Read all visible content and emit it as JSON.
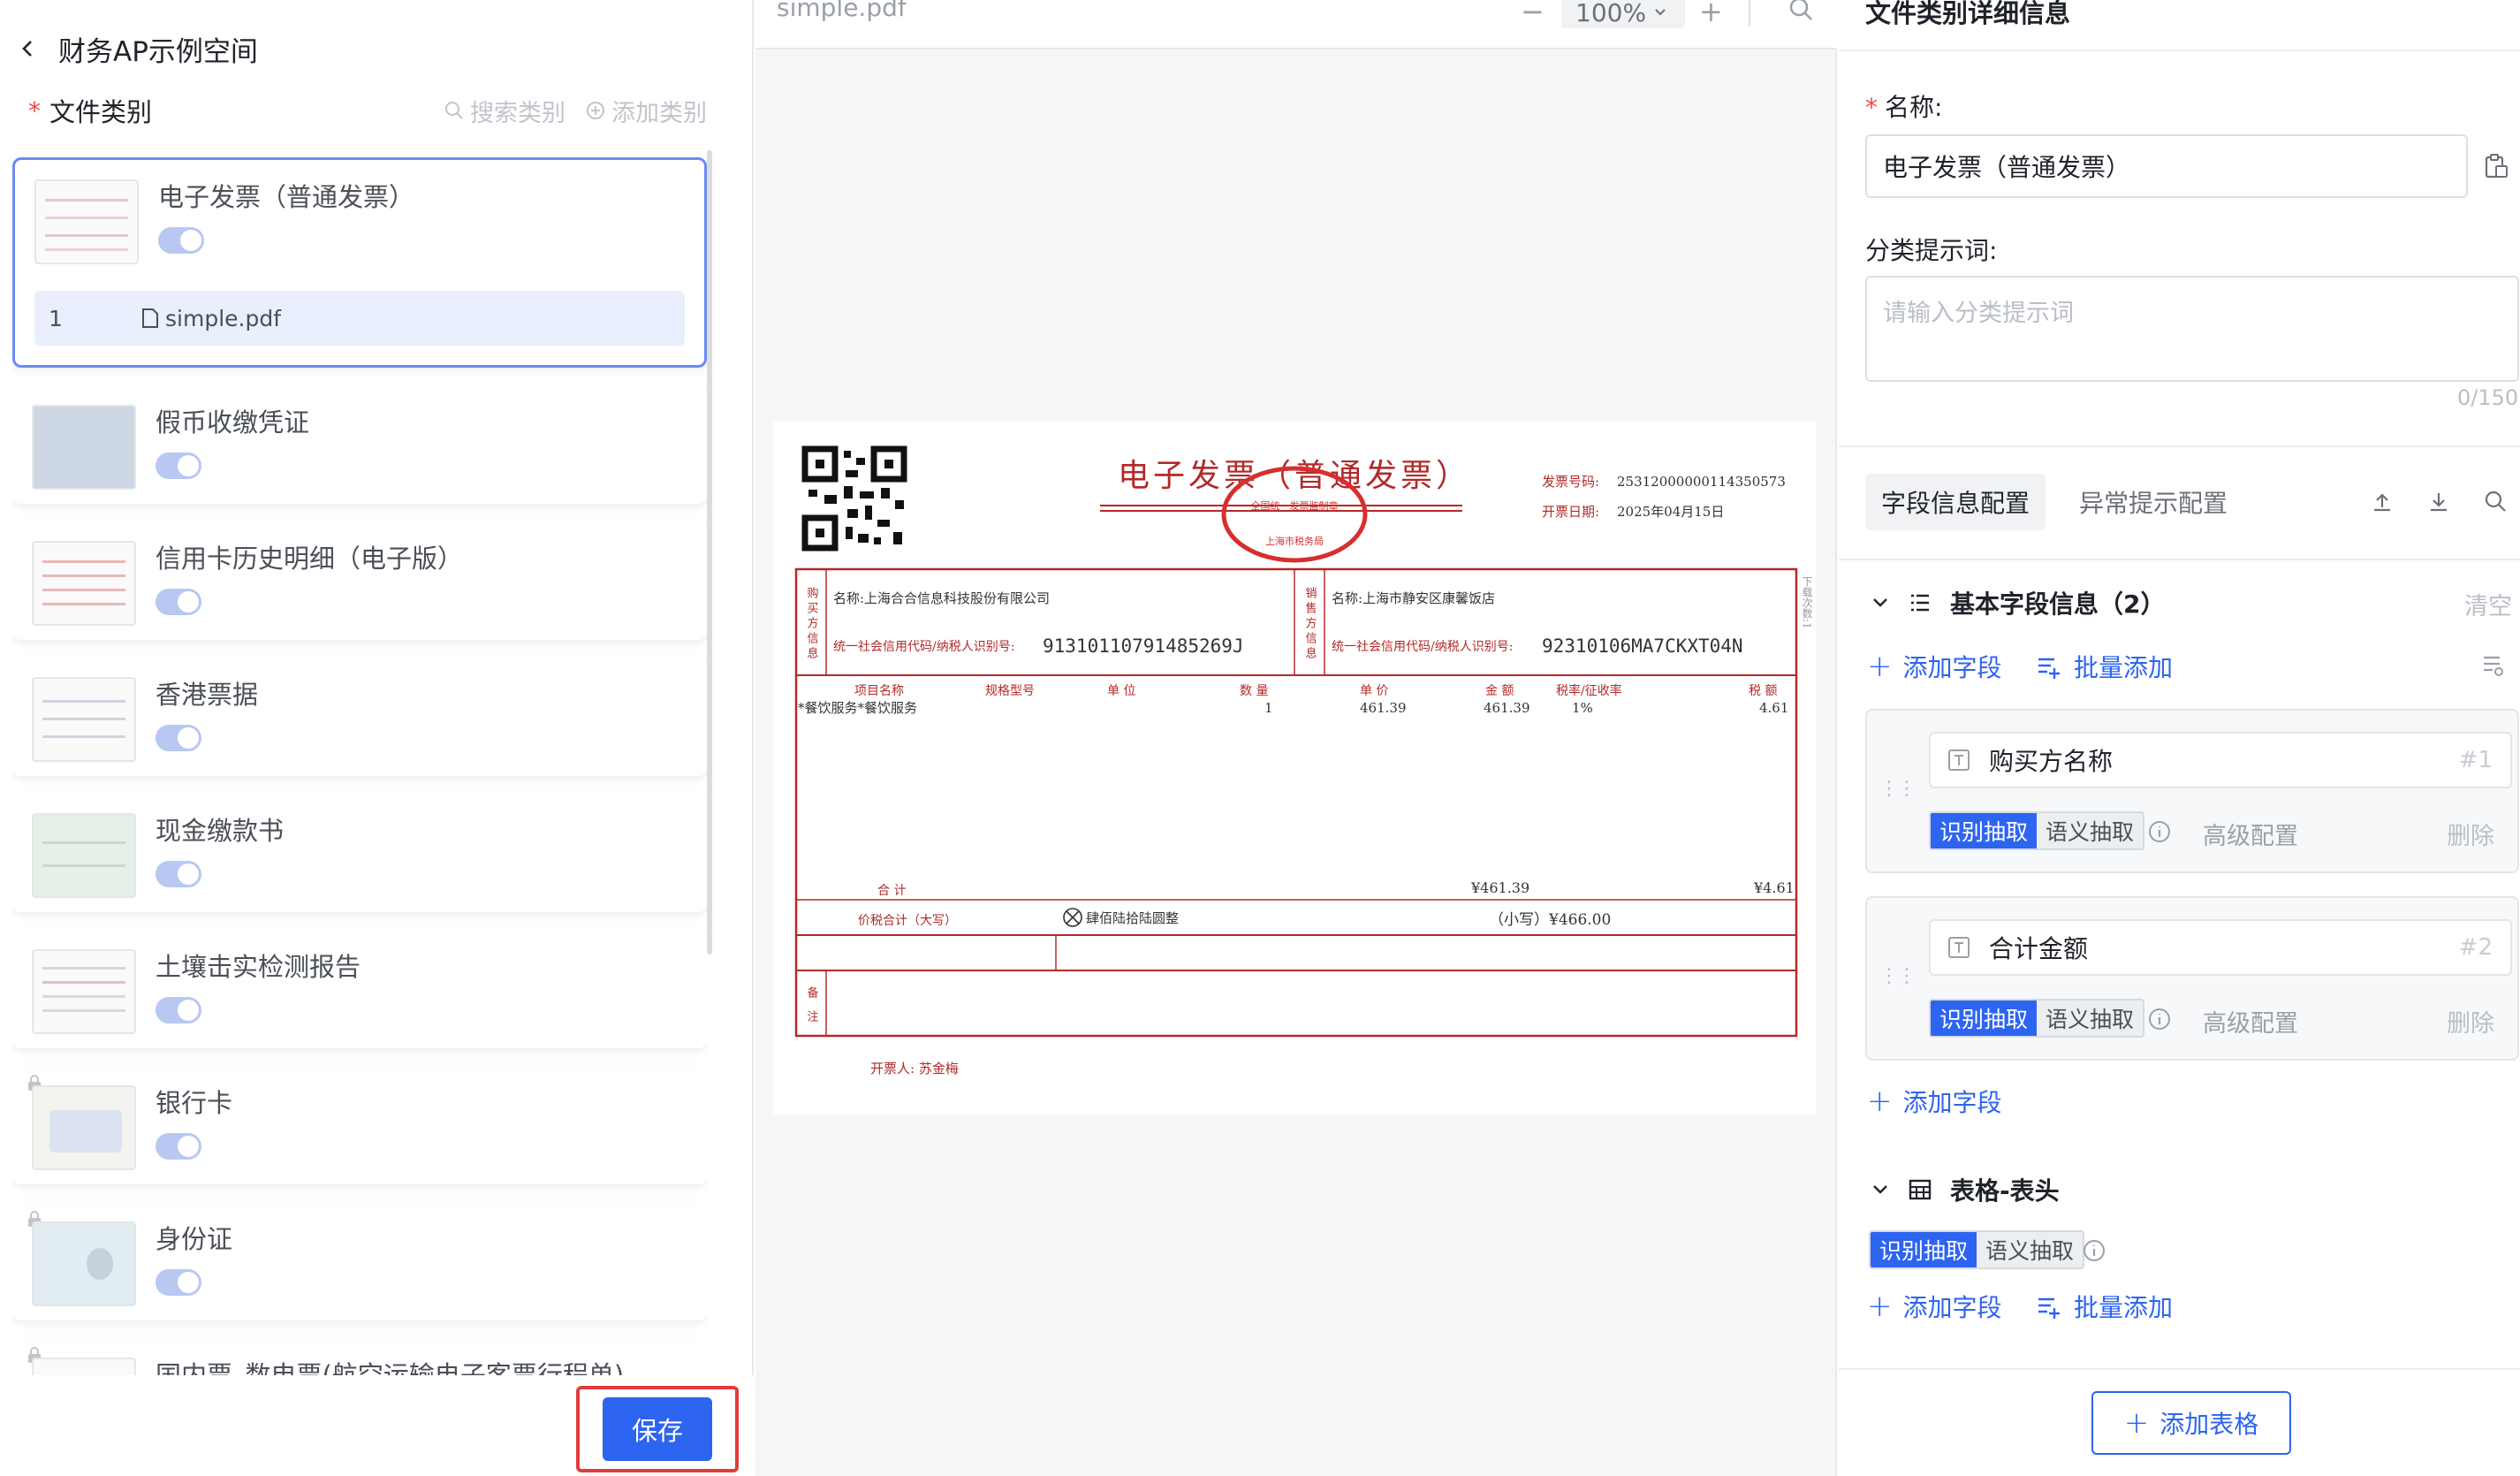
{
  "left": {
    "title": "财务AP示例空间",
    "category_label": "文件类别",
    "search_label": "搜索类别",
    "add_label": "添加类别",
    "items": [
      {
        "name": "电子发票（普通发票）",
        "enabled": true
      },
      {
        "name": "假币收缴凭证",
        "enabled": true
      },
      {
        "name": "信用卡历史明细（电子版）",
        "enabled": true
      },
      {
        "name": "香港票据",
        "enabled": true
      },
      {
        "name": "现金缴款书",
        "enabled": true
      },
      {
        "name": "土壤击实检测报告",
        "enabled": true
      },
      {
        "name": "银行卡",
        "enabled": true
      },
      {
        "name": "身份证",
        "enabled": true
      },
      {
        "name": "国内票_数电票(航空运输电子客票行程单)",
        "enabled": true
      }
    ],
    "file": {
      "index": "1",
      "name": "simple.pdf"
    },
    "save_label": "保存"
  },
  "viewer": {
    "file_name": "simple.pdf",
    "zoom": "100%",
    "invoice": {
      "title": "电子发票（普通发票）",
      "invoice_no_label": "发票号码:",
      "invoice_no": "25312000000114350573",
      "date_label": "开票日期:",
      "date": "2025年04月15日",
      "buyer_side": "购买方信息",
      "seller_side": "销售方信息",
      "buyer_name": "名称:上海合合信息科技股份有限公司",
      "buyer_tax": "统一社会信用代码/纳税人识别号:",
      "buyer_tax_no": "91310110791485269J",
      "seller_name": "名称:上海市静安区康馨饭店",
      "seller_tax": "统一社会信用代码/纳税人识别号:",
      "seller_tax_no": "92310106MA7CKXT04N",
      "col_item": "项目名称",
      "col_spec": "规格型号",
      "col_unit": "单  位",
      "col_qty": "数  量",
      "col_price": "单  价",
      "col_amount": "金  额",
      "col_rate": "税率/征收率",
      "col_tax": "税  额",
      "row_item": "*餐饮服务*餐饮服务",
      "row_qty": "1",
      "row_price": "461.39",
      "row_amount": "461.39",
      "row_rate": "1%",
      "row_tax": "4.61",
      "total_label": "合      计",
      "total_amount": "¥461.39",
      "total_tax": "¥4.61",
      "grand_label": "价税合计（大写）",
      "grand_words": "肆佰陆拾陆圆整",
      "grand_small": "（小写）¥466.00",
      "note_label": "备注",
      "issuer": "开票人: 苏金梅",
      "side_text": "下载次数:1",
      "stamp_text": "全国统一发票监制章",
      "stamp_sub": "上海市税务局"
    }
  },
  "right": {
    "title": "文件类别详细信息",
    "name_label": "名称:",
    "name_value": "电子发票（普通发票）",
    "prompt_label": "分类提示词:",
    "prompt_placeholder": "请输入分类提示词",
    "prompt_counter": "0/150",
    "tabs": [
      "字段信息配置",
      "异常提示配置"
    ],
    "basic_section": "基本字段信息（2）",
    "clear_label": "清空",
    "add_field": "添加字段",
    "batch_add": "批量添加",
    "fields": [
      {
        "name": "购买方名称",
        "num": "#1"
      },
      {
        "name": "合计金额",
        "num": "#2"
      }
    ],
    "mode_on": "识别抽取",
    "mode_off": "语义抽取",
    "advanced": "高级配置",
    "delete": "删除",
    "table_section": "表格-表头",
    "add_table": "添加表格"
  },
  "colors": {
    "accent": "#2d64f0",
    "invoice_red": "#b22a2a",
    "highlight": "#e23c3c"
  }
}
